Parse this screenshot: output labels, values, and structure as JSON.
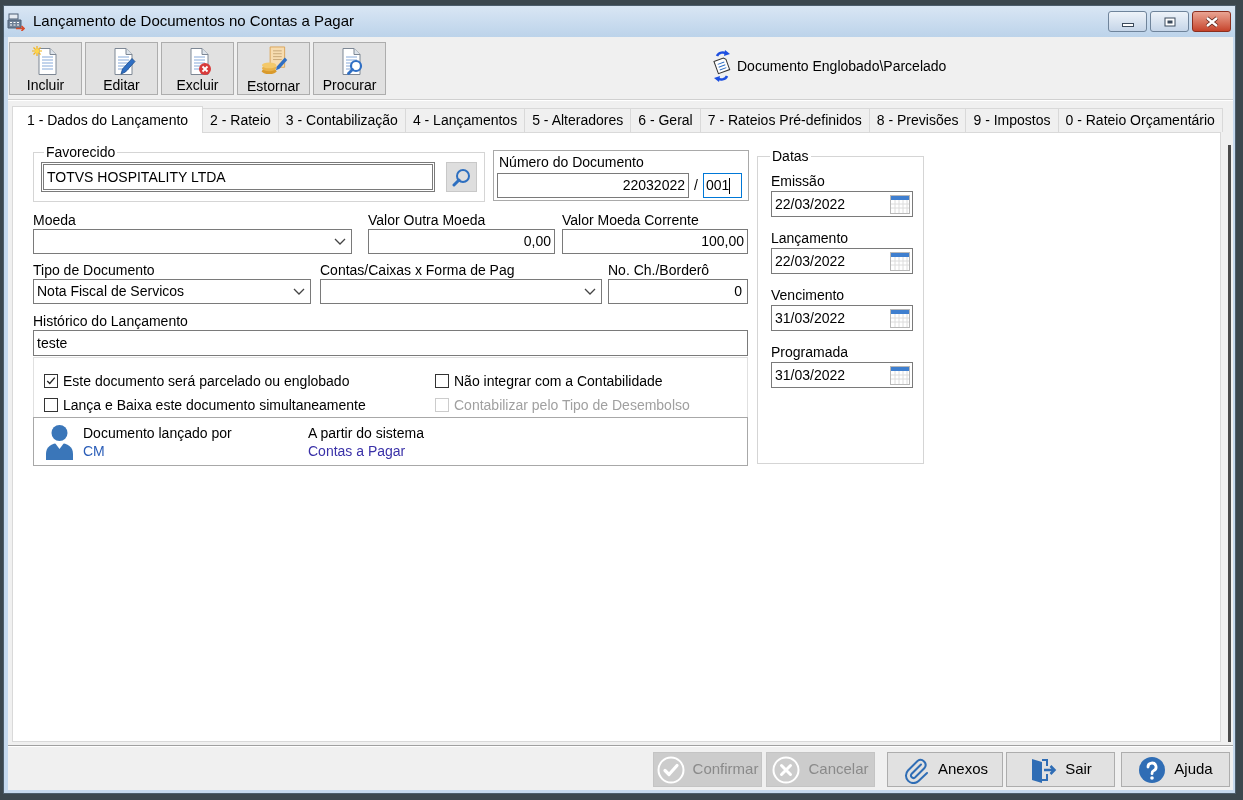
{
  "window": {
    "title": "Lançamento de Documentos no Contas a Pagar"
  },
  "toolbar": {
    "buttons": [
      {
        "kind": "new",
        "label": "Incluir"
      },
      {
        "kind": "edit",
        "label": "Editar"
      },
      {
        "kind": "delete",
        "label": "Excluir"
      },
      {
        "kind": "reverse",
        "label": "Estornar"
      },
      {
        "kind": "search",
        "label": "Procurar"
      }
    ],
    "status": "Documento Englobado\\Parcelado"
  },
  "tabs": [
    {
      "label": "1 - Dados do Lançamento",
      "selected": true
    },
    {
      "label": "2 - Rateio",
      "selected": false
    },
    {
      "label": "3 - Contabilização",
      "selected": false
    },
    {
      "label": "4 - Lançamentos",
      "selected": false
    },
    {
      "label": "5 - Alteradores",
      "selected": false
    },
    {
      "label": "6 - Geral",
      "selected": false
    },
    {
      "label": "7 - Rateios Pré-definidos",
      "selected": false
    },
    {
      "label": "8 - Previsões",
      "selected": false
    },
    {
      "label": "9 - Impostos",
      "selected": false
    },
    {
      "label": "0 - Rateio Orçamentário",
      "selected": false
    }
  ],
  "form": {
    "favorecido": {
      "label": "Favorecido",
      "value": "TOTVS HOSPITALITY LTDA"
    },
    "numero_documento": {
      "label": "Número do Documento",
      "number": "22032022",
      "separator": "/",
      "parcel": {
        "value": "001",
        "focused": true
      }
    },
    "moeda": {
      "label": "Moeda"
    },
    "valor_outra_moeda": {
      "label": "Valor Outra Moeda",
      "value": "0,00"
    },
    "valor_moeda_corrente": {
      "label": "Valor Moeda Corrente",
      "value": "100,00"
    },
    "tipo_documento": {
      "label": "Tipo de Documento",
      "value": "Nota Fiscal de Servicos"
    },
    "contas_caixas": {
      "label": "Contas/Caixas x Forma de Pag"
    },
    "cheque_bordero": {
      "label": "No. Ch./Borderô",
      "value": "0"
    },
    "historico": {
      "label": "Histórico do Lançamento",
      "value": "teste"
    },
    "options": [
      {
        "label": "Este documento será parcelado ou englobado",
        "checked": true,
        "disabled": false
      },
      {
        "label": "Não integrar com a Contabilidade",
        "checked": false,
        "disabled": false
      },
      {
        "label": "Lança e Baixa este documento simultaneamente",
        "checked": false,
        "disabled": false
      },
      {
        "label": "Contabilizar pelo Tipo de Desembolso",
        "checked": false,
        "disabled": true
      }
    ],
    "origin": {
      "user_label": "Documento lançado por",
      "user": "CM",
      "system_label": "A partir do sistema",
      "system": "Contas a Pagar"
    }
  },
  "dates": {
    "title": "Datas",
    "fields": [
      {
        "label": "Emissão",
        "value": "22/03/2022"
      },
      {
        "label": "Lançamento",
        "value": "22/03/2022"
      },
      {
        "label": "Vencimento",
        "value": "31/03/2022"
      },
      {
        "label": "Programada",
        "value": "31/03/2022"
      }
    ]
  },
  "footer_buttons": [
    {
      "kind": "confirm",
      "label": "Confirmar",
      "disabled": true
    },
    {
      "kind": "cancel",
      "label": "Cancelar",
      "disabled": true
    },
    {
      "kind": "attach",
      "label": "Anexos",
      "disabled": false
    },
    {
      "kind": "exit",
      "label": "Sair",
      "disabled": false
    },
    {
      "kind": "help",
      "label": "Ajuda",
      "disabled": false
    }
  ]
}
